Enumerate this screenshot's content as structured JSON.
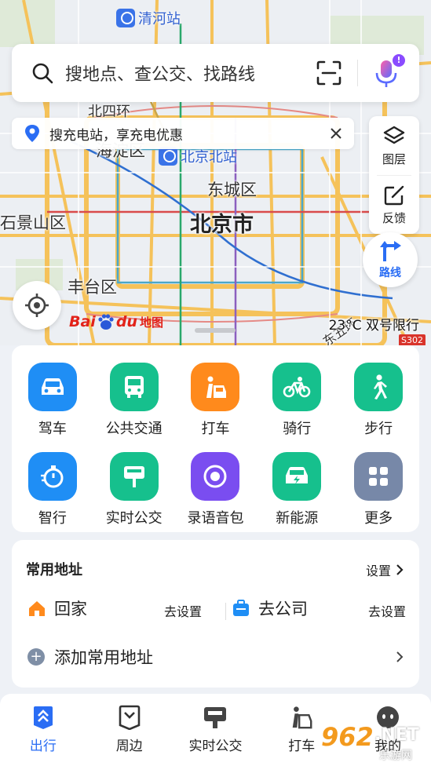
{
  "map": {
    "station_top": "清河站",
    "station_north": "北京北站",
    "districts": [
      "海淀区",
      "东城区",
      "石景山区",
      "丰台区",
      "北四环"
    ],
    "city": "北京市",
    "logo_word": "Bai",
    "logo_word2": "du",
    "logo_suffix": "地图",
    "weather": "23°C 双号限行",
    "road_badge": "S302",
    "road_name": "东五环"
  },
  "search": {
    "placeholder": "搜地点、查公交、找路线",
    "mic_badge": "!"
  },
  "promo": {
    "text": "搜充电站，享充电优惠"
  },
  "map_tools": {
    "layers_label": "图层",
    "feedback_label": "反馈",
    "route_label": "路线"
  },
  "quick_functions": [
    {
      "label": "驾车",
      "icon": "car-icon",
      "color": "#1f8ef5"
    },
    {
      "label": "公共交通",
      "icon": "bus-icon",
      "color": "#16c08d"
    },
    {
      "label": "打车",
      "icon": "taxi-icon",
      "color": "#ff8a1c"
    },
    {
      "label": "骑行",
      "icon": "bike-icon",
      "color": "#16c08d"
    },
    {
      "label": "步行",
      "icon": "walk-icon",
      "color": "#16c08d"
    },
    {
      "label": "智行",
      "icon": "stopwatch-icon",
      "color": "#1f8ef5"
    },
    {
      "label": "实时公交",
      "icon": "bus-stop-icon",
      "color": "#16c08d"
    },
    {
      "label": "录语音包",
      "icon": "voice-record-icon",
      "color": "#7a4df0"
    },
    {
      "label": "新能源",
      "icon": "ev-car-icon",
      "color": "#16c08d"
    },
    {
      "label": "更多",
      "icon": "grid-icon",
      "color": "#7788a8"
    }
  ],
  "addresses": {
    "title": "常用地址",
    "settings": "设置",
    "home": {
      "name": "回家",
      "action": "去设置",
      "color": "#ff8a1c"
    },
    "work": {
      "name": "去公司",
      "action": "去设置",
      "color": "#1f8ef5"
    },
    "add": "添加常用地址"
  },
  "nav": [
    {
      "label": "出行",
      "icon": "travel-icon",
      "active": true
    },
    {
      "label": "周边",
      "icon": "nearby-icon",
      "active": false
    },
    {
      "label": "实时公交",
      "icon": "realtime-bus-icon",
      "active": false
    },
    {
      "label": "打车",
      "icon": "taxi-nav-icon",
      "active": false
    },
    {
      "label": "我的",
      "icon": "profile-icon",
      "active": false
    }
  ],
  "watermark": {
    "num": "962",
    "net": ".NET",
    "sub": "乐游网"
  },
  "colors": {
    "accent": "#2a6df4",
    "panel_bg": "#eef1f6"
  }
}
